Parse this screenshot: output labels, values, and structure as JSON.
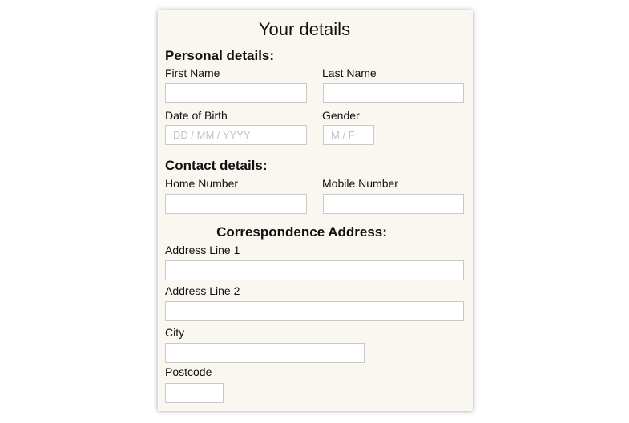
{
  "form": {
    "title": "Your details",
    "personal": {
      "heading": "Personal details:",
      "first_name_label": "First Name",
      "first_name_value": "",
      "last_name_label": "Last Name",
      "last_name_value": "",
      "dob_label": "Date of Birth",
      "dob_value": "",
      "dob_placeholder": "DD / MM / YYYY",
      "gender_label": "Gender",
      "gender_value": "",
      "gender_placeholder": "M / F"
    },
    "contact": {
      "heading": "Contact details:",
      "home_label": "Home Number",
      "home_value": "",
      "mobile_label": "Mobile Number",
      "mobile_value": ""
    },
    "address": {
      "heading": "Correspondence Address:",
      "line1_label": "Address Line 1",
      "line1_value": "",
      "line2_label": "Address Line 2",
      "line2_value": "",
      "city_label": "City",
      "city_value": "",
      "postcode_label": "Postcode",
      "postcode_value": ""
    }
  }
}
